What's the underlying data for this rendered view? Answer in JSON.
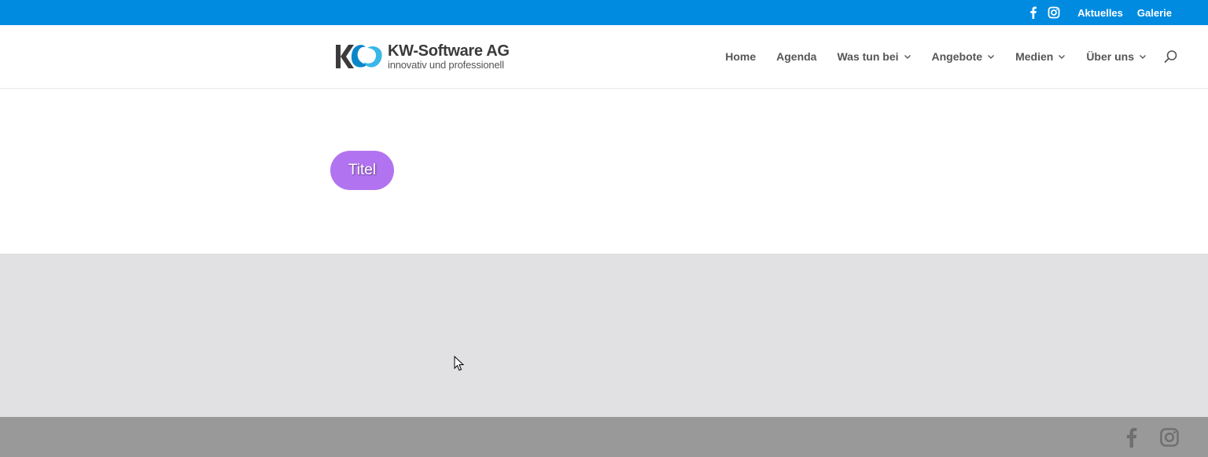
{
  "topbar": {
    "background": "#008be1",
    "social": [
      "facebook-icon",
      "instagram-icon"
    ],
    "links": [
      {
        "label": "Aktuelles"
      },
      {
        "label": "Galerie"
      }
    ]
  },
  "header": {
    "logo": {
      "brand": "KW-Software AG",
      "tagline": "innovativ und professionell"
    },
    "nav": [
      {
        "label": "Home",
        "has_dropdown": false
      },
      {
        "label": "Agenda",
        "has_dropdown": false
      },
      {
        "label": "Was tun bei",
        "has_dropdown": true
      },
      {
        "label": "Angebote",
        "has_dropdown": true
      },
      {
        "label": "Medien",
        "has_dropdown": true
      },
      {
        "label": "Über uns",
        "has_dropdown": true
      }
    ],
    "search_icon": "search-icon"
  },
  "main": {
    "title_button": "Titel",
    "title_button_color": "#b273f0"
  },
  "section": {
    "background": "#e1e1e4"
  },
  "footer": {
    "background": "#999999",
    "social": [
      "facebook-icon",
      "instagram-icon"
    ]
  }
}
